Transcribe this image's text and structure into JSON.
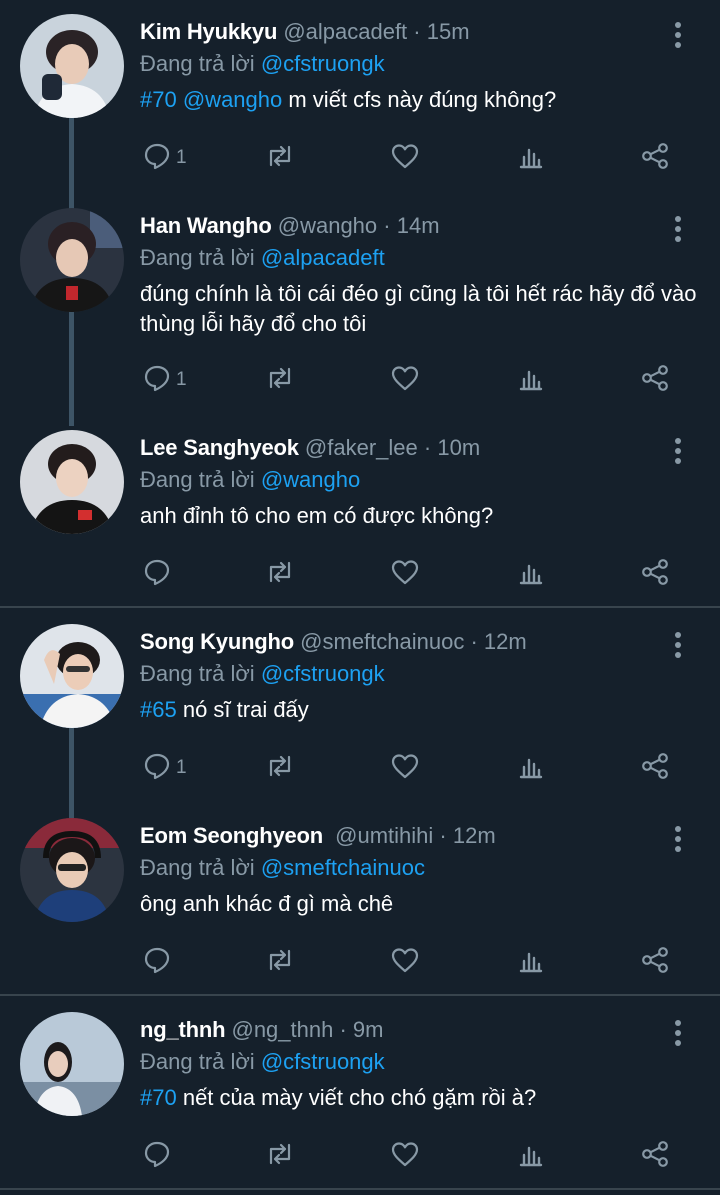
{
  "colors": {
    "background": "#15202b",
    "link": "#1da1f2",
    "muted": "#8899a6",
    "thread": "#3d5466"
  },
  "tweets": [
    {
      "name": "Kim Hyukkyu",
      "handle": "@alpacadeft",
      "sep": "·",
      "time": "15m",
      "reply_prefix": "Đang trả lời",
      "reply_to": "@cfstruongk",
      "body": {
        "tag": "#70",
        "mention": "@wangho",
        "text": " m viết cfs này đúng không?"
      },
      "reply_count": "1"
    },
    {
      "name": "Han Wangho",
      "handle": "@wangho",
      "sep": "·",
      "time": "14m",
      "reply_prefix": "Đang trả lời",
      "reply_to": "@alpacadeft",
      "body": {
        "text": "đúng chính là tôi cái đéo gì cũng là tôi hết rác hãy đổ vào thùng lỗi hãy đổ cho tôi"
      },
      "reply_count": "1"
    },
    {
      "name": "Lee Sanghyeok",
      "handle": "@faker_lee",
      "sep": "·",
      "time": "10m",
      "reply_prefix": "Đang trả lời",
      "reply_to": "@wangho",
      "body": {
        "text": "anh đỉnh tô cho em có được không?"
      },
      "reply_count": ""
    },
    {
      "name": "Song Kyungho",
      "handle": "@smeftchainuoc",
      "sep": "·",
      "time": "12m",
      "reply_prefix": "Đang trả lời",
      "reply_to": "@cfstruongk",
      "body": {
        "tag": "#65",
        "text": " nó sĩ trai đấy"
      },
      "reply_count": "1"
    },
    {
      "name": "Eom Seonghyeon",
      "handle": "@umtihihi",
      "sep": "·",
      "time": "12m",
      "reply_prefix": "Đang trả lời",
      "reply_to": "@smeftchainuoc",
      "body": {
        "text": "ông anh khác đ gì mà chê"
      },
      "reply_count": ""
    },
    {
      "name": "ng_thnh",
      "handle": "@ng_thnh",
      "sep": "·",
      "time": "9m",
      "reply_prefix": "Đang trả lời",
      "reply_to": "@cfstruongk",
      "body": {
        "tag": "#70",
        "text": " nết của mày viết cho chó gặm rồi à?"
      },
      "reply_count": ""
    }
  ],
  "icons": [
    "reply-icon",
    "retweet-icon",
    "like-icon",
    "analytics-icon",
    "share-icon",
    "more-options-icon"
  ]
}
